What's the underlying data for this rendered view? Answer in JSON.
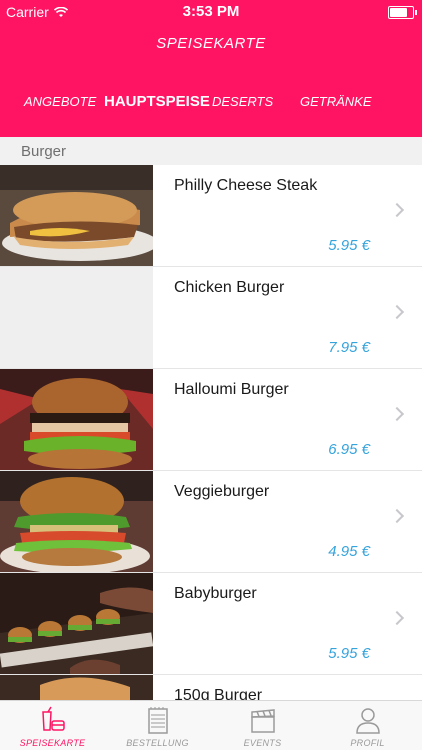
{
  "status_bar": {
    "carrier": "Carrier",
    "time": "3:53 PM",
    "battery_level": 0.85
  },
  "header": {
    "title": "SPEISEKARTE"
  },
  "tabs": [
    {
      "label": "ANGEBOTE",
      "active": false
    },
    {
      "label": "HAUPTSPEISE",
      "active": true
    },
    {
      "label": "DESERTS",
      "active": false
    },
    {
      "label": "GETRÄNKE",
      "active": false
    }
  ],
  "section": {
    "title": "Burger"
  },
  "items": [
    {
      "name": "Philly Cheese Steak",
      "price": "5.95 €",
      "image": "philly-cheese-steak-photo"
    },
    {
      "name": "Chicken Burger",
      "price": "7.95 €",
      "image": null
    },
    {
      "name": "Halloumi Burger",
      "price": "6.95 €",
      "image": "halloumi-burger-photo"
    },
    {
      "name": "Veggieburger",
      "price": "4.95 €",
      "image": "veggieburger-photo"
    },
    {
      "name": "Babyburger",
      "price": "5.95 €",
      "image": "babyburger-photo"
    },
    {
      "name": "150g Burger",
      "price": "",
      "image": "150g-burger-photo"
    }
  ],
  "tabbar": [
    {
      "label": "SPEISEKARTE",
      "icon": "drink-food-icon",
      "active": true
    },
    {
      "label": "BESTELLUNG",
      "icon": "notepad-icon",
      "active": false
    },
    {
      "label": "EVENTS",
      "icon": "clapperboard-icon",
      "active": false
    },
    {
      "label": "PROFIL",
      "icon": "person-icon",
      "active": false
    }
  ],
  "colors": {
    "brand": "#ff1464",
    "price": "#35a3dc",
    "inactive": "#9a9a9a"
  }
}
